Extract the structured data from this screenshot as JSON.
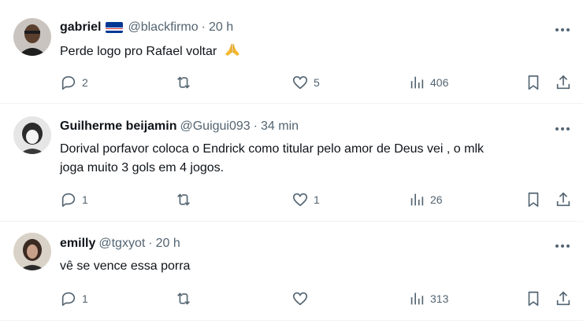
{
  "tweets": [
    {
      "name": "gabriel",
      "handle": "@blackfirmo",
      "separator": "·",
      "time": "20 h",
      "text": "Perde logo pro Rafael voltar",
      "emoji": "folded-hands",
      "replies": "2",
      "retweets": "",
      "likes": "5",
      "views": "406",
      "flag": "cape-verde-flag"
    },
    {
      "name": "Guilherme beijamin",
      "handle": "@Guigui093",
      "separator": "·",
      "time": "34 min",
      "text_line1": "Dorival porfavor coloca o Endrick como titular pelo amor de Deus vei , o mlk",
      "text_line2": "joga muito 3 gols em 4 jogos.",
      "replies": "1",
      "retweets": "",
      "likes": "1",
      "views": "26"
    },
    {
      "name": "emilly",
      "handle": "@tgxyot",
      "separator": "·",
      "time": "20 h",
      "text": "vê se vence essa porra",
      "replies": "1",
      "retweets": "",
      "likes": "",
      "views": "313"
    }
  ],
  "colors": {
    "text": "#0f1419",
    "secondary": "#536471",
    "divider": "#eff3f4"
  }
}
